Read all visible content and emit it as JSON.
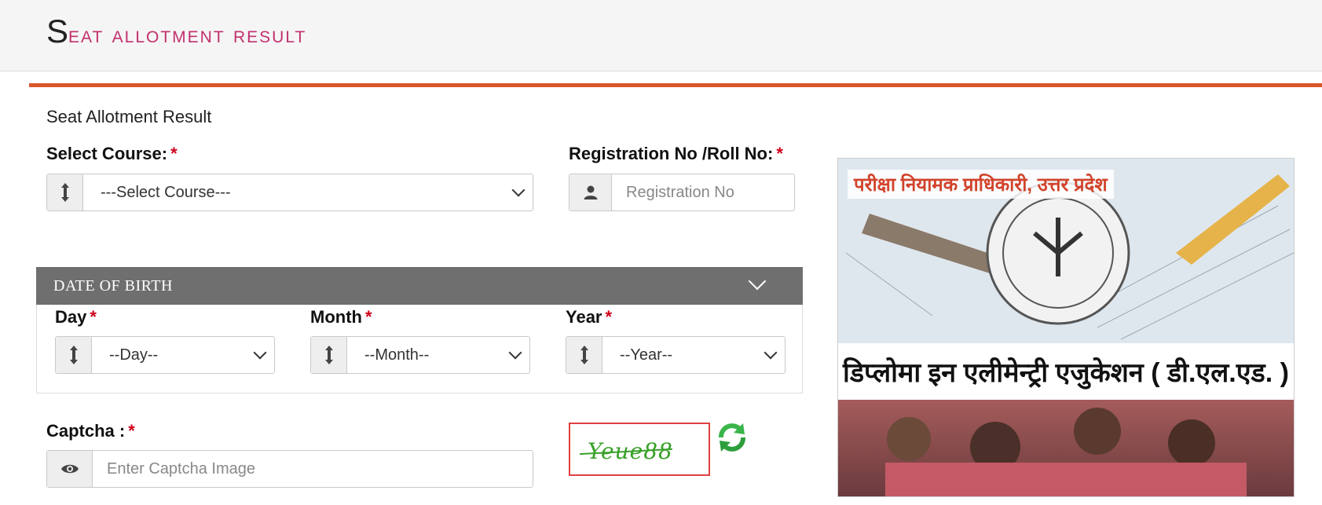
{
  "header": {
    "title_first": "S",
    "title_rest": "EAT ALLOTMENT RESULT"
  },
  "panel": {
    "heading": "Seat Allotment Result"
  },
  "form": {
    "course_label": "Select Course:",
    "course_value": "---Select Course---",
    "registration_label": "Registration No /Roll No:",
    "registration_placeholder": "Registration No",
    "required_mark": "*",
    "dob_section_title": "DATE OF BIRTH",
    "day_label": "Day",
    "day_value": "--Day--",
    "month_label": "Month",
    "month_value": "--Month--",
    "year_label": "Year",
    "year_value": "--Year--",
    "captcha_label": "Captcha :",
    "captcha_placeholder": "Enter Captcha Image",
    "captcha_text": "Yeue88"
  },
  "icons": {
    "select_addon": "vertical-arrows-icon",
    "registration_addon": "user-icon",
    "captcha_addon": "eye-icon",
    "refresh": "refresh-icon"
  },
  "promo": {
    "header_text": "परीक्षा नियामक प्राधिकारी, उत्तर प्रदेश",
    "caption": "डिप्लोमा इन एलीमेन्ट्री एजुकेशन ( डी.एल.एड. )"
  },
  "colors": {
    "title_accent": "#c2306d",
    "accent_bar": "#d9572b",
    "required": "#d0021b",
    "captcha_green": "#3aa02a",
    "dob_header_bg": "#6f6f6f"
  }
}
